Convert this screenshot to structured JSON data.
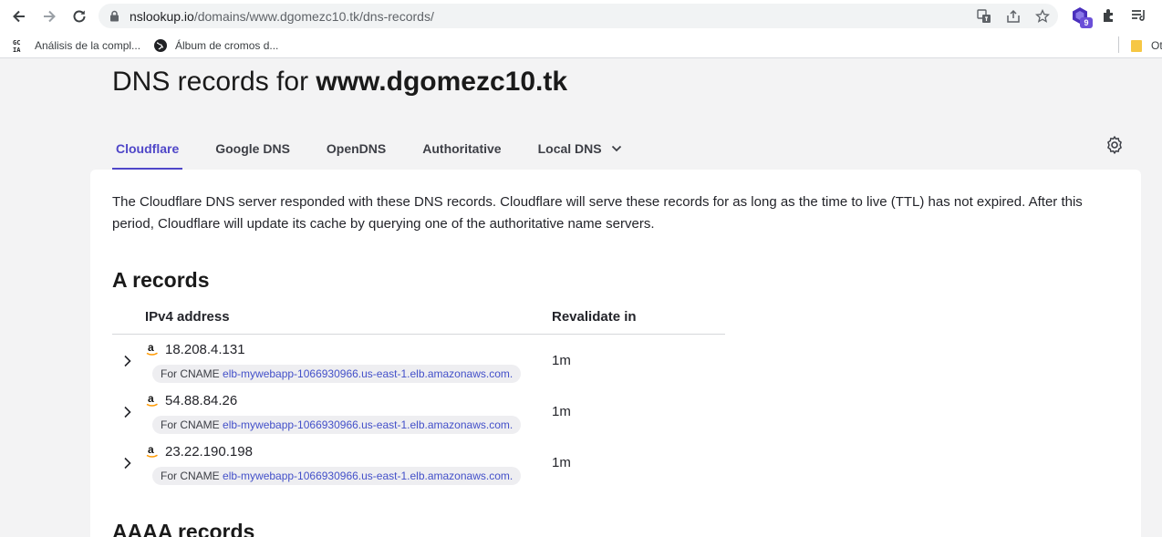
{
  "browser": {
    "url_host": "nslookup.io",
    "url_path": "/domains/www.dgomezc10.tk/dns-records/",
    "extension_badge": "9",
    "bookmarks": [
      {
        "label": "Análisis de la compl...",
        "icon": "ai-icon"
      },
      {
        "label": "Álbum de cromos d...",
        "icon": "globe-icon"
      }
    ],
    "overflow_bookmark": "Ot"
  },
  "page": {
    "title_prefix": "DNS records for ",
    "title_domain": "www.dgomezc10.tk",
    "tabs": [
      {
        "label": "Cloudflare",
        "active": true
      },
      {
        "label": "Google DNS",
        "active": false
      },
      {
        "label": "OpenDNS",
        "active": false
      },
      {
        "label": "Authoritative",
        "active": false
      },
      {
        "label": "Local DNS",
        "active": false,
        "dropdown": true
      }
    ],
    "intro": "The Cloudflare DNS server responded with these DNS records. Cloudflare will serve these records for as long as the time to live (TTL) has not expired. After this period, Cloudflare will update its cache by querying one of the authoritative name servers.",
    "a_records": {
      "title": "A records",
      "col_address": "IPv4 address",
      "col_revalidate": "Revalidate in",
      "cname_prefix": "For CNAME ",
      "rows": [
        {
          "ip": "18.208.4.131",
          "cname": "elb-mywebapp-1066930966.us-east-1.elb.amazonaws.com.",
          "ttl": "1m"
        },
        {
          "ip": "54.88.84.26",
          "cname": "elb-mywebapp-1066930966.us-east-1.elb.amazonaws.com.",
          "ttl": "1m"
        },
        {
          "ip": "23.22.190.198",
          "cname": "elb-mywebapp-1066930966.us-east-1.elb.amazonaws.com.",
          "ttl": "1m"
        }
      ]
    },
    "aaaa_records": {
      "title": "AAAA records"
    }
  },
  "colors": {
    "accent": "#4f46c8",
    "link": "#4350c9",
    "amazon_orange": "#ff9900"
  }
}
